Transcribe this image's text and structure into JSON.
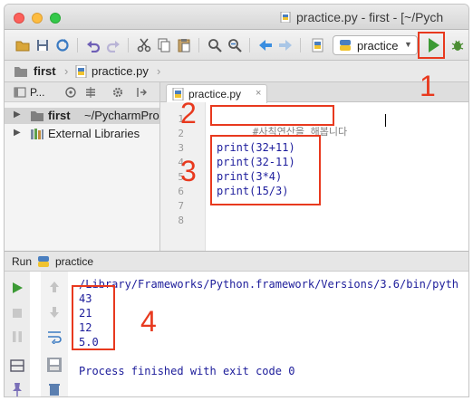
{
  "window": {
    "title": "practice.py - first - [~/Pych",
    "traffic_lights": [
      "close",
      "minimize",
      "zoom"
    ]
  },
  "toolbar": {
    "run_config": "practice",
    "icons": [
      "open-folder-icon",
      "save-icon",
      "sync-icon",
      "undo-icon",
      "redo-icon",
      "cut-icon",
      "copy-icon",
      "paste-icon",
      "find-icon",
      "replace-icon",
      "back-icon",
      "forward-icon",
      "python-file-icon",
      "run-icon",
      "debug-icon"
    ]
  },
  "navbar": {
    "project": "first",
    "file": "practice.py"
  },
  "project_panel": {
    "header_label": "P...",
    "tree": [
      {
        "name": "first",
        "path": "~/PycharmPro",
        "expanded": false,
        "selected": true
      },
      {
        "name": "External Libraries",
        "path": "",
        "expanded": false,
        "selected": false
      }
    ]
  },
  "editor": {
    "tab_label": "practice.py",
    "tab_close": "×",
    "line_numbers": [
      "1",
      "2",
      "3",
      "4",
      "5",
      "6",
      "7",
      "8"
    ],
    "lines": [
      "#사칙연산을 해봅니다",
      "",
      "print(32+11)",
      "print(32-11)",
      "print(3*4)",
      "print(15/3)",
      "",
      ""
    ]
  },
  "run_panel": {
    "label": "Run",
    "config": "practice",
    "command": "/Library/Frameworks/Python.framework/Versions/3.6/bin/pyth",
    "output": [
      "43",
      "21",
      "12",
      "5.0"
    ],
    "exit_message": "Process finished with exit code 0"
  },
  "annotations": {
    "step1": "1",
    "step2": "2",
    "step3": "3",
    "step4": "4",
    "color": "#e8391e"
  },
  "colors": {
    "run_green": "#3c9a35",
    "code_blue": "#1d1d9c",
    "comment_gray": "#808080"
  }
}
